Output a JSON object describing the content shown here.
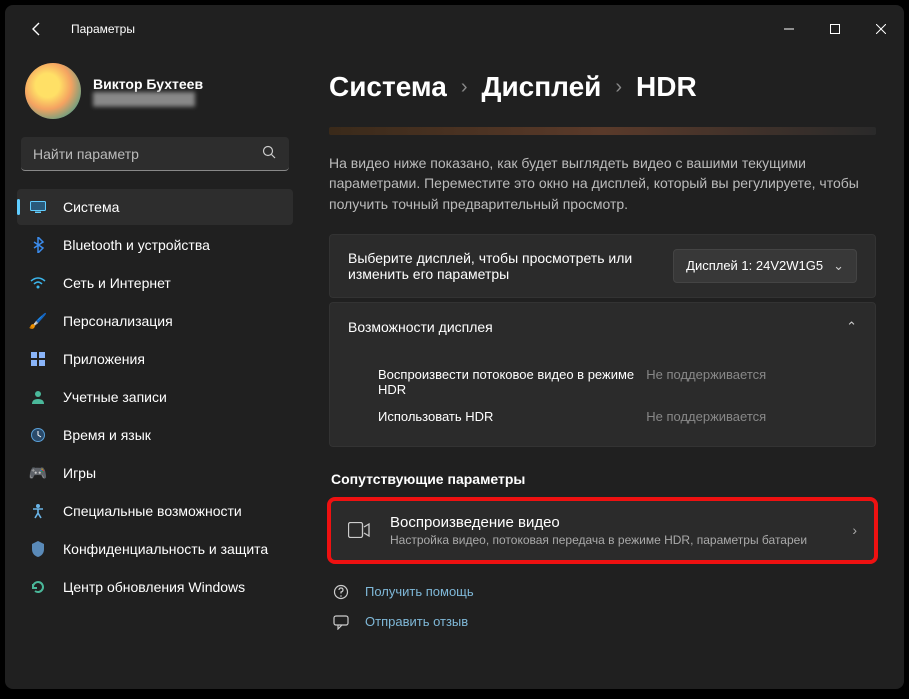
{
  "titlebar": {
    "title": "Параметры"
  },
  "profile": {
    "name": "Виктор Бухтеев",
    "email": "████████████"
  },
  "search": {
    "placeholder": "Найти параметр"
  },
  "sidebar": {
    "items": [
      {
        "label": "Система",
        "icon": "🖥️",
        "active": true
      },
      {
        "label": "Bluetooth и устройства",
        "icon": "bt"
      },
      {
        "label": "Сеть и Интернет",
        "icon": "wifi"
      },
      {
        "label": "Персонализация",
        "icon": "🖌️"
      },
      {
        "label": "Приложения",
        "icon": "apps"
      },
      {
        "label": "Учетные записи",
        "icon": "👤"
      },
      {
        "label": "Время и язык",
        "icon": "clock"
      },
      {
        "label": "Игры",
        "icon": "🎮"
      },
      {
        "label": "Специальные возможности",
        "icon": "acc"
      },
      {
        "label": "Конфиденциальность и защита",
        "icon": "🛡️"
      },
      {
        "label": "Центр обновления Windows",
        "icon": "upd"
      }
    ]
  },
  "breadcrumb": {
    "root": "Система",
    "mid": "Дисплей",
    "leaf": "HDR"
  },
  "description": "На видео ниже показано, как будет выглядеть видео с вашими текущими параметрами. Переместите это окно на дисплей, который вы регулируете, чтобы получить точный предварительный просмотр.",
  "displaySelect": {
    "label": "Выберите дисплей, чтобы просмотреть или изменить его параметры",
    "value": "Дисплей 1: 24V2W1G5"
  },
  "capabilities": {
    "header": "Возможности дисплея",
    "rows": [
      {
        "label": "Воспроизвести потоковое видео в режиме HDR",
        "value": "Не поддерживается"
      },
      {
        "label": "Использовать HDR",
        "value": "Не поддерживается"
      }
    ]
  },
  "related": {
    "title": "Сопутствующие параметры",
    "videoPlayback": {
      "title": "Воспроизведение видео",
      "sub": "Настройка видео, потоковая передача в режиме HDR, параметры батареи"
    }
  },
  "links": {
    "help": "Получить помощь",
    "feedback": "Отправить отзыв"
  }
}
